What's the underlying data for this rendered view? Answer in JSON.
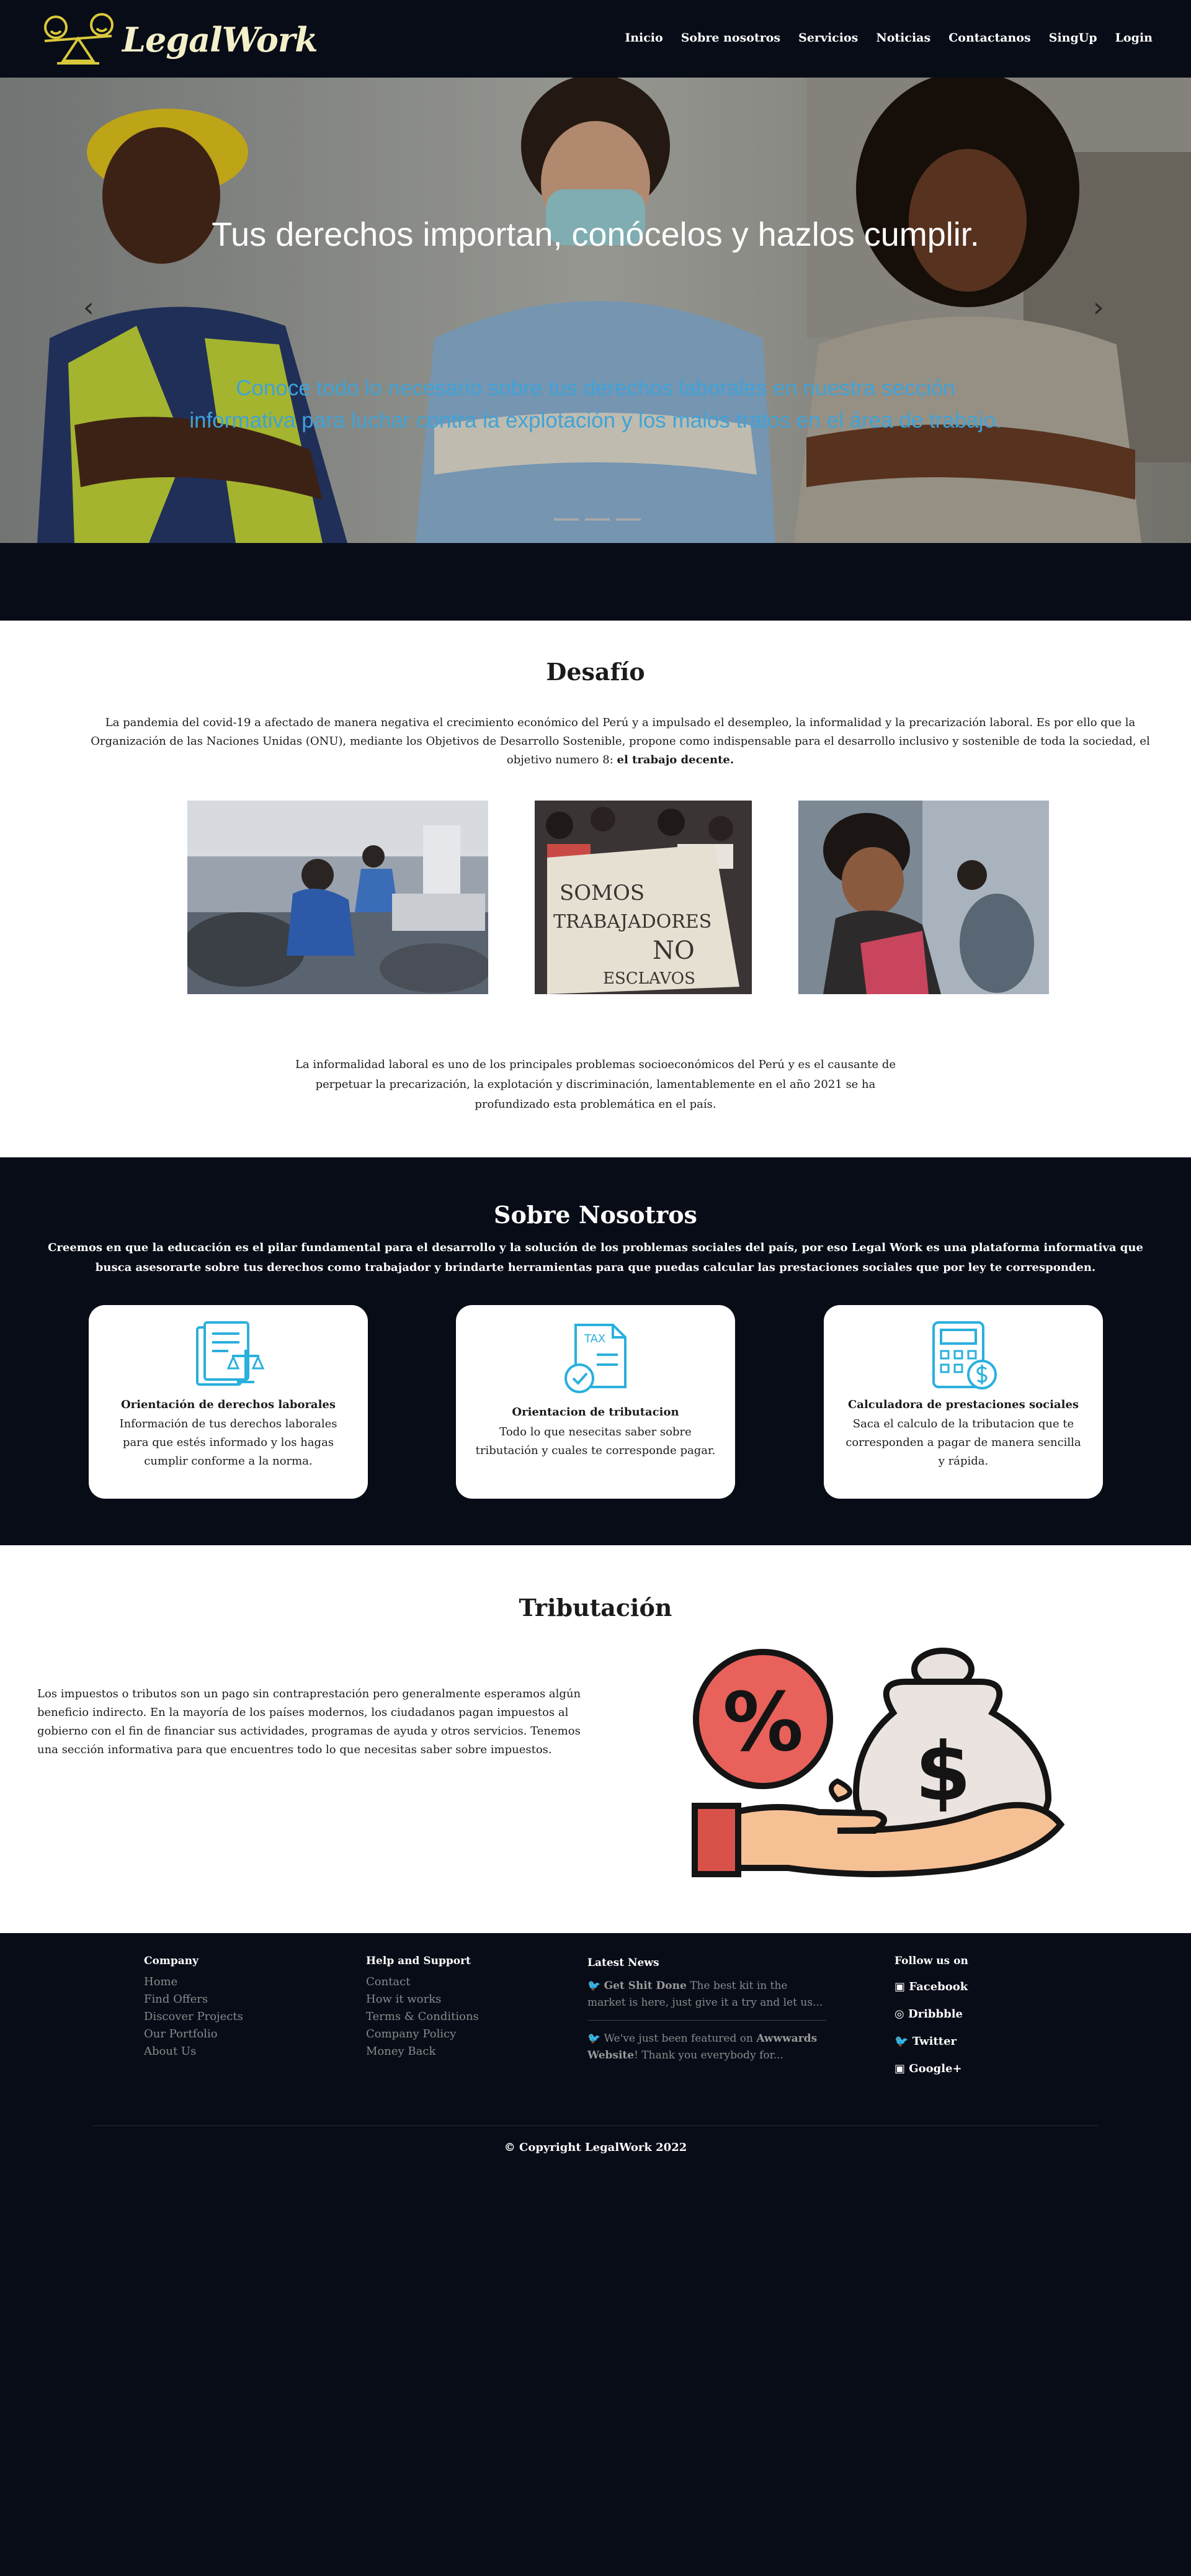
{
  "nav": {
    "logo_text": "LegalWork",
    "items": [
      "Inicio",
      "Sobre nosotros",
      "Servicios",
      "Noticias",
      "Contactanos",
      "SingUp",
      "Login"
    ]
  },
  "hero": {
    "title": "Tus derechos importan, conócelos y hazlos cumplir.",
    "subtitle": "Conoce todo lo necesario sobre tus derechos laborales en nuestra sección informativa para luchar contra la explotación y los malos tratos en el área de trabajo.",
    "prev_icon": "‹",
    "next_icon": "›",
    "slide_count": 3
  },
  "desafio": {
    "title": "Desafío",
    "paragraph": "La pandemia del covid-19 a afectado de manera negativa el crecimiento económico del Perú y a impulsado el desempleo, la informalidad y la precarización laboral. Es por ello que la Organización de las Naciones Unidas (ONU), mediante los Objetivos de Desarrollo Sostenible, propone como indispensable para el desarrollo inclusivo y sostenible de toda la sociedad, el objetivo numero 8:",
    "paragraph_bold": "el trabajo decente.",
    "protest_sign": [
      "SOMOS",
      "TRABAJADORES",
      "NO",
      "ESCLAVOS"
    ],
    "paragraph2": "La informalidad laboral es uno de los principales problemas socioeconómicos del Perú y es el causante de perpetuar la precarización, la explotación y discriminación, lamentablemente en el año 2021 se ha profundizado esta problemática en el país."
  },
  "sobre": {
    "title": "Sobre Nosotros",
    "paragraph": "Creemos en que la educación es el pilar fundamental para el desarrollo y la solución de los problemas sociales del país, por eso Legal Work es una plataforma informativa que busca asesorarte sobre tus derechos como trabajador y brindarte herramientas para que puedas calcular las prestaciones sociales que por ley te corresponden.",
    "cards": [
      {
        "icon": "legal-document-icon",
        "title": "Orientación de derechos laborales",
        "text": "Información de tus derechos laborales para que estés informado y los hagas cumplir conforme a la norma."
      },
      {
        "icon": "tax-document-icon",
        "icon_label": "TAX",
        "title": "Orientacion de tributacion",
        "text": "Todo lo que nesecitas saber sobre tributación y cuales te corresponde pagar."
      },
      {
        "icon": "calculator-icon",
        "title": "Calculadora de prestaciones sociales",
        "text": "Saca el calculo de la tributacion que te corresponden a pagar de manera sencilla y rápida."
      }
    ]
  },
  "tributacion": {
    "title": "Tributación",
    "paragraph": "Los impuestos o tributos son un pago sin contraprestación pero generalmente esperamos algún beneficio indirecto. En la mayoría de los países modernos, los ciudadanos pagan impuestos al gobierno con el fin de financiar sus actividades, programas de ayuda y otros servicios. Tenemos una sección informativa para que encuentres todo lo que necesitas saber sobre impuestos."
  },
  "footer": {
    "company": {
      "title": "Company",
      "links": [
        "Home",
        "Find Offers",
        "Discover Projects",
        "Our Portfolio",
        "About Us"
      ]
    },
    "help": {
      "title": "Help and Support",
      "links": [
        "Contact",
        "How it works",
        "Terms & Conditions",
        "Company Policy",
        "Money Back"
      ]
    },
    "news": {
      "title": "Latest News",
      "items": [
        {
          "bold": "Get Shit Done",
          "text": "The best kit in the market is here, just give it a try and let us..."
        },
        {
          "pre": "We've just been featured on",
          "bold": "Awwwards Website",
          "text": "! Thank you everybody for..."
        }
      ]
    },
    "social": {
      "title": "Follow us on",
      "links": [
        "Facebook",
        "Dribbble",
        "Twitter",
        "Google+"
      ]
    },
    "copyright": "© Copyright LegalWork 2022"
  },
  "colors": {
    "dark": "#080c17",
    "accent_blue": "#3fa3d8",
    "logo_gold": "#d9c83a",
    "icon_blue": "#2ab0dd"
  }
}
